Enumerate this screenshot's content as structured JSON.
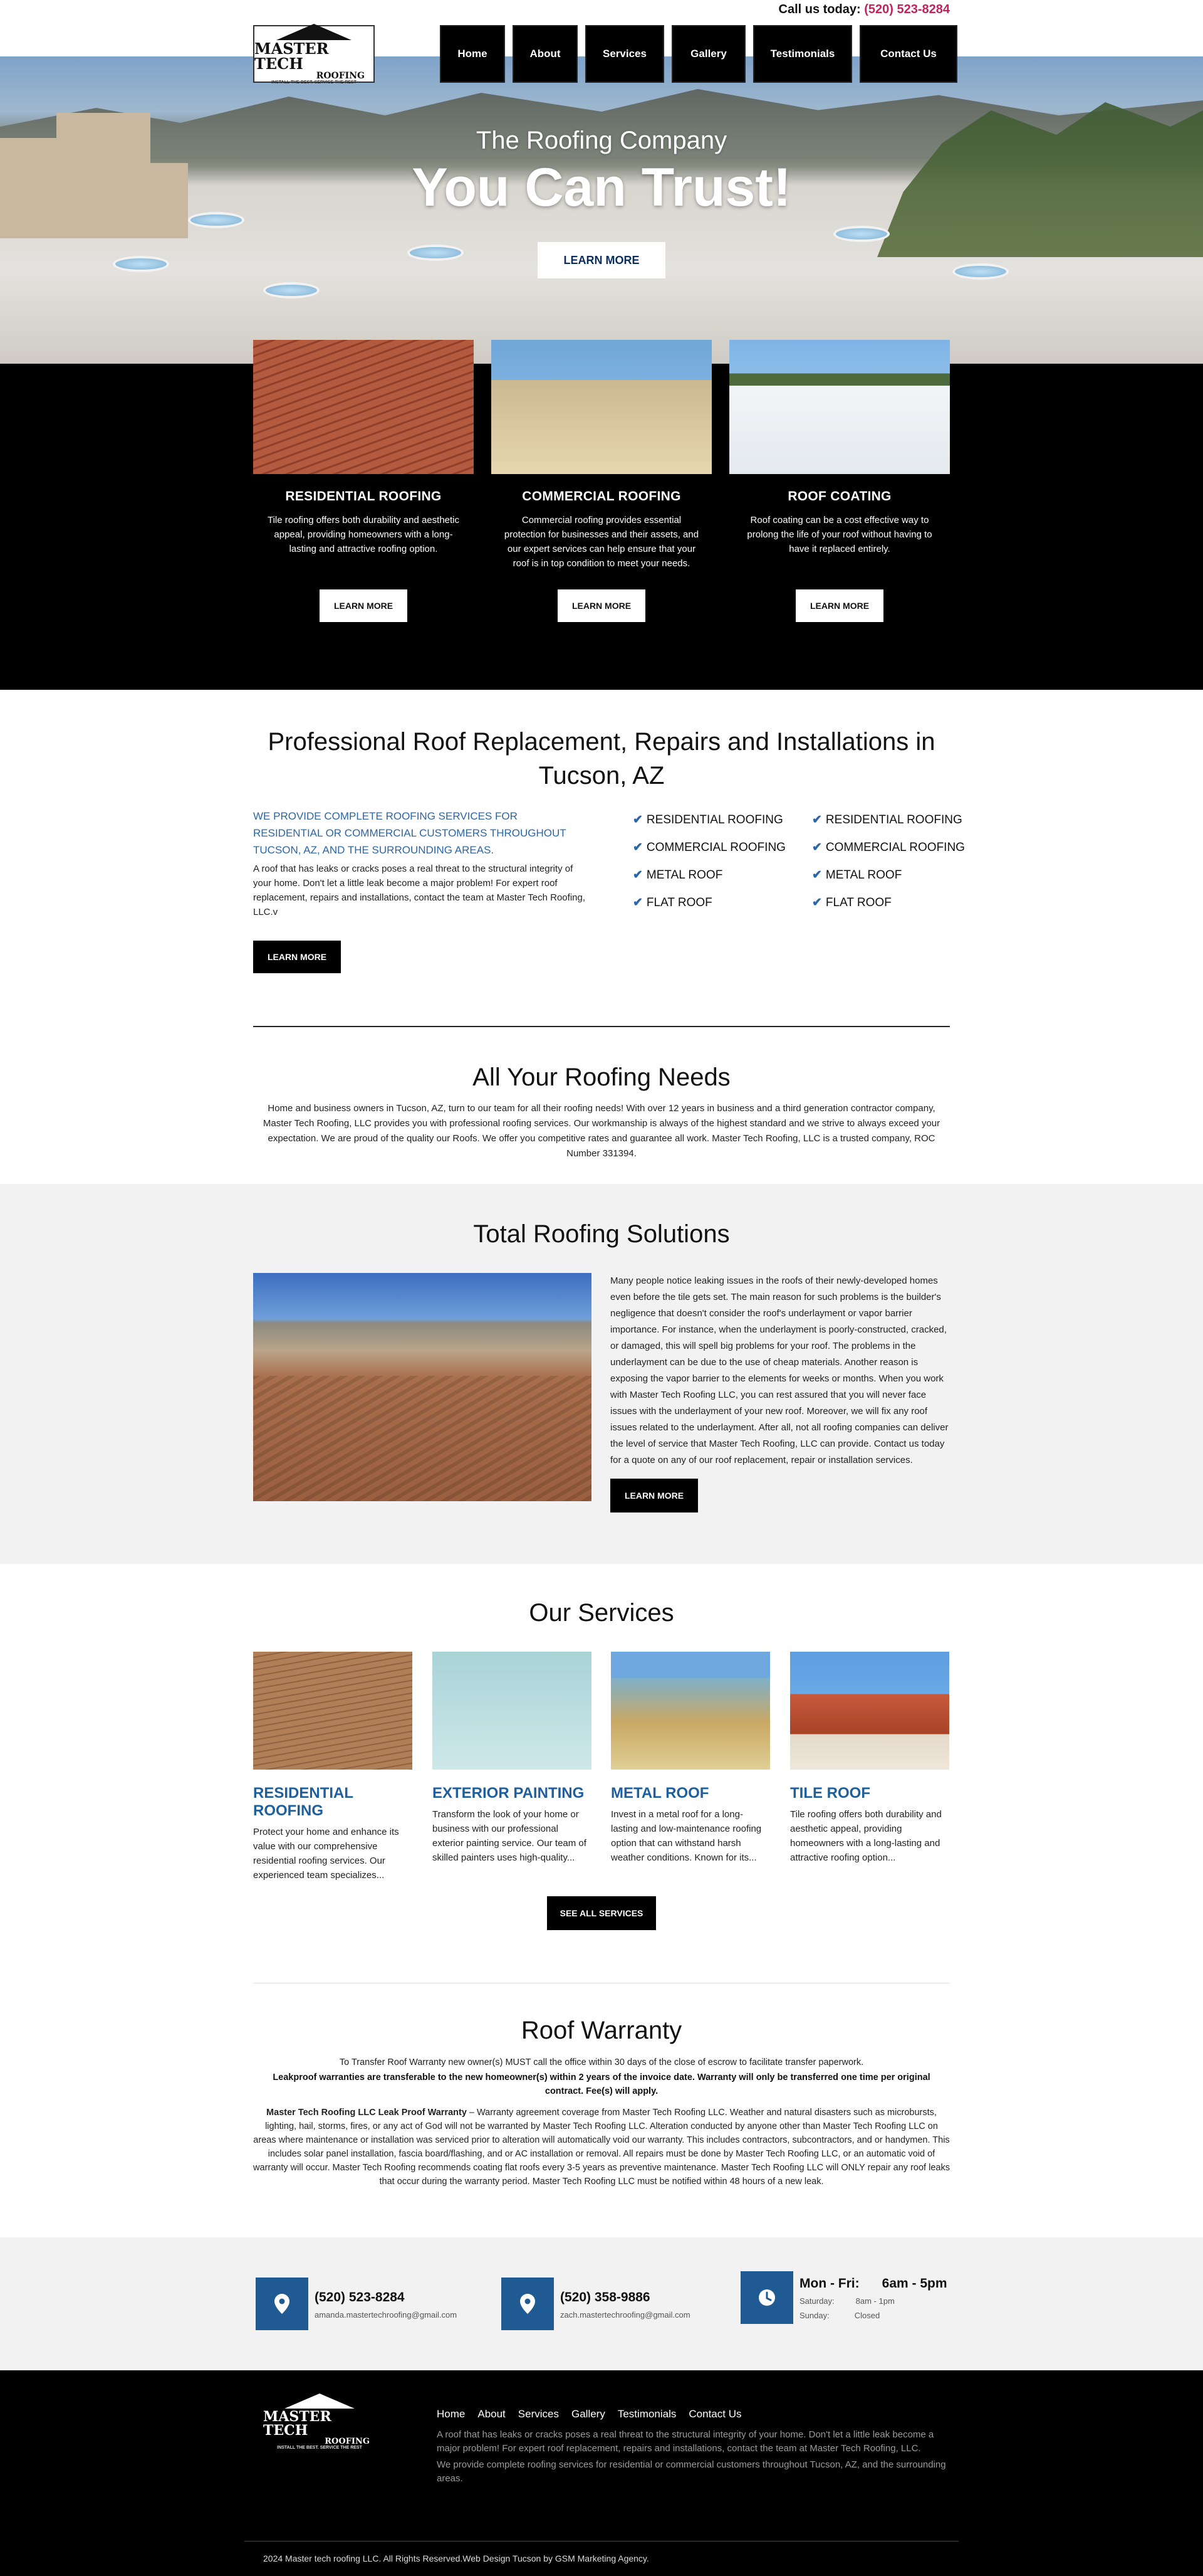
{
  "header": {
    "call_label": "Call us today:",
    "call_phone": "(520) 523-8284",
    "logo_line1": "MASTER TECH",
    "logo_line2": "ROOFING",
    "logo_tagline": "INSTALL THE BEST. SERVICE THE REST"
  },
  "nav": [
    "Home",
    "About",
    "Services",
    "Gallery",
    "Testimonials",
    "Contact Us"
  ],
  "hero": {
    "subtitle": "The Roofing Company",
    "title": "You Can Trust!",
    "button": "LEARN MORE"
  },
  "cards": [
    {
      "title": "RESIDENTIAL ROOFING",
      "text": "Tile roofing offers both durability and aesthetic appeal, providing homeowners with a long-lasting and attractive roofing option.",
      "button": "LEARN MORE"
    },
    {
      "title": "COMMERCIAL ROOFING",
      "text": "Commercial roofing provides essential protection for businesses and their assets, and our expert services can help ensure that your roof is in top condition to meet your needs.",
      "button": "LEARN MORE"
    },
    {
      "title": "ROOF COATING",
      "text": "Roof coating can be a cost effective way to prolong the life of your roof without having to have it replaced entirely.",
      "button": "LEARN MORE"
    }
  ],
  "professional": {
    "heading": "Professional Roof Replacement, Repairs and Installations in Tucson, AZ",
    "blue_text": "WE PROVIDE COMPLETE ROOFING SERVICES FOR RESIDENTIAL OR COMMERCIAL CUSTOMERS THROUGHOUT TUCSON, AZ, AND THE SURROUNDING AREAS.",
    "paragraph": "A roof that has leaks or cracks poses a real threat to the structural integrity of your home. Don't let a little leak become a major problem! For expert roof replacement, repairs and installations, contact the team at Master Tech Roofing, LLC.v",
    "button": "LEARN MORE",
    "list_col1": [
      "RESIDENTIAL ROOFING",
      "COMMERCIAL ROOFING",
      "METAL ROOF",
      "FLAT ROOF"
    ],
    "list_col2": [
      "RESIDENTIAL ROOFING",
      "COMMERCIAL ROOFING",
      "METAL ROOF",
      "FLAT ROOF"
    ]
  },
  "needs": {
    "heading": "All Your Roofing Needs",
    "text": "Home and business owners in Tucson, AZ, turn to our team for all their roofing needs! With over 12 years in business and a third generation contractor company, Master Tech Roofing, LLC provides you with professional roofing services. Our workmanship is always of the highest standard and we strive to always exceed your expectation. We are proud of the quality our Roofs. We offer you competitive rates and guarantee all work. Master Tech Roofing, LLC is a trusted company, ROC Number 331394."
  },
  "solutions": {
    "heading": "Total Roofing Solutions",
    "text": "Many people notice leaking issues in the roofs of their newly-developed homes even before the tile gets set. The main reason for such problems is the builder's negligence that doesn't consider the roof's underlayment or vapor barrier importance. For instance, when the underlayment is poorly-constructed, cracked, or damaged, this will spell big problems for your roof. The problems in the underlayment can be due to the use of cheap materials. Another reason is exposing the vapor barrier to the elements for weeks or months. When you work with Master Tech Roofing LLC, you can rest assured that you will never face issues with the underlayment of your new roof. Moreover, we will fix any roof issues related to the underlayment. After all, not all roofing companies can deliver the level of service that Master Tech Roofing, LLC can provide. Contact us today for a quote on any of our roof replacement, repair or installation services.",
    "button": "LEARN MORE"
  },
  "services": {
    "heading": "Our Services",
    "items": [
      {
        "title": "RESIDENTIAL ROOFING",
        "text": "Protect your home and enhance its value with our comprehensive residential roofing services. Our experienced team specializes..."
      },
      {
        "title": "EXTERIOR PAINTING",
        "text": "Transform the look of your home or business with our professional exterior painting service. Our team of skilled painters uses high-quality..."
      },
      {
        "title": "METAL ROOF",
        "text": "Invest in a metal roof for a long-lasting and low-maintenance roofing option that can withstand harsh weather conditions. Known for its..."
      },
      {
        "title": "TILE ROOF",
        "text": "Tile roofing offers both durability and aesthetic appeal, providing homeowners with a long-lasting and attractive roofing option..."
      }
    ],
    "button": "SEE ALL SERVICES"
  },
  "warranty": {
    "heading": "Roof Warranty",
    "line1": "To Transfer Roof Warranty new owner(s) MUST call the office within 30 days of the close of escrow to facilitate transfer paperwork.",
    "line2": "Leakproof warranties are transferable to the new homeowner(s) within 2 years of the invoice date. Warranty will only be transferred one time per original contract. Fee(s) will apply.",
    "line3_bold": "Master Tech Roofing LLC Leak Proof Warranty",
    "line3": " – Warranty agreement coverage from Master Tech Roofing LLC. Weather and natural disasters such as microbursts, lighting, hail, storms, fires, or any act of God will not be warranted by Master Tech Roofing LLC. Alteration conducted by anyone other than Master Tech Roofing LLC on areas where maintenance or installation was serviced prior to alteration will automatically void our warranty. This includes contractors, subcontractors, and or handymen. This includes solar panel installation, fascia board/flashing, and or AC installation or removal. All repairs must be done by Master Tech Roofing LLC, or an automatic void of warranty will occur. Master Tech Roofing recommends coating flat roofs every 3-5 years as preventive maintenance. Master Tech Roofing LLC will ONLY repair any roof leaks that occur during the warranty period. Master Tech Roofing LLC must be notified within 48 hours of a new leak."
  },
  "contact": [
    {
      "icon": "location-pin-icon",
      "phone": "(520) 523-8284",
      "email": "amanda.mastertechroofing@gmail.com"
    },
    {
      "icon": "location-pin-icon",
      "phone": "(520) 358-9886",
      "email": "zach.mastertechroofing@gmail.com"
    }
  ],
  "hours": {
    "icon": "clock-icon",
    "days": "Mon - Fri:",
    "time": "6am - 5pm",
    "sat_label": "Saturday:",
    "sat_time": "8am - 1pm",
    "sun_label": "Sunday:",
    "sun_time": "Closed"
  },
  "footer": {
    "nav": [
      "Home",
      "About",
      "Services",
      "Gallery",
      "Testimonials",
      "Contact Us"
    ],
    "p1": "A roof that has leaks or cracks poses a real threat to the structural integrity of your home. Don't let a little leak become a major problem! For expert roof replacement, repairs and installations, contact the team at Master Tech Roofing, LLC.",
    "p2": "We provide complete roofing services for residential or commercial customers throughout Tucson, AZ, and the surrounding areas.",
    "copyright": "2024 Master tech roofing LLC. All Rights Reserved.Web Design Tucson by GSM Marketing Agency."
  },
  "colors": {
    "accent_blue": "#1f5a92",
    "phone_red": "#c0245a",
    "black": "#000000"
  }
}
